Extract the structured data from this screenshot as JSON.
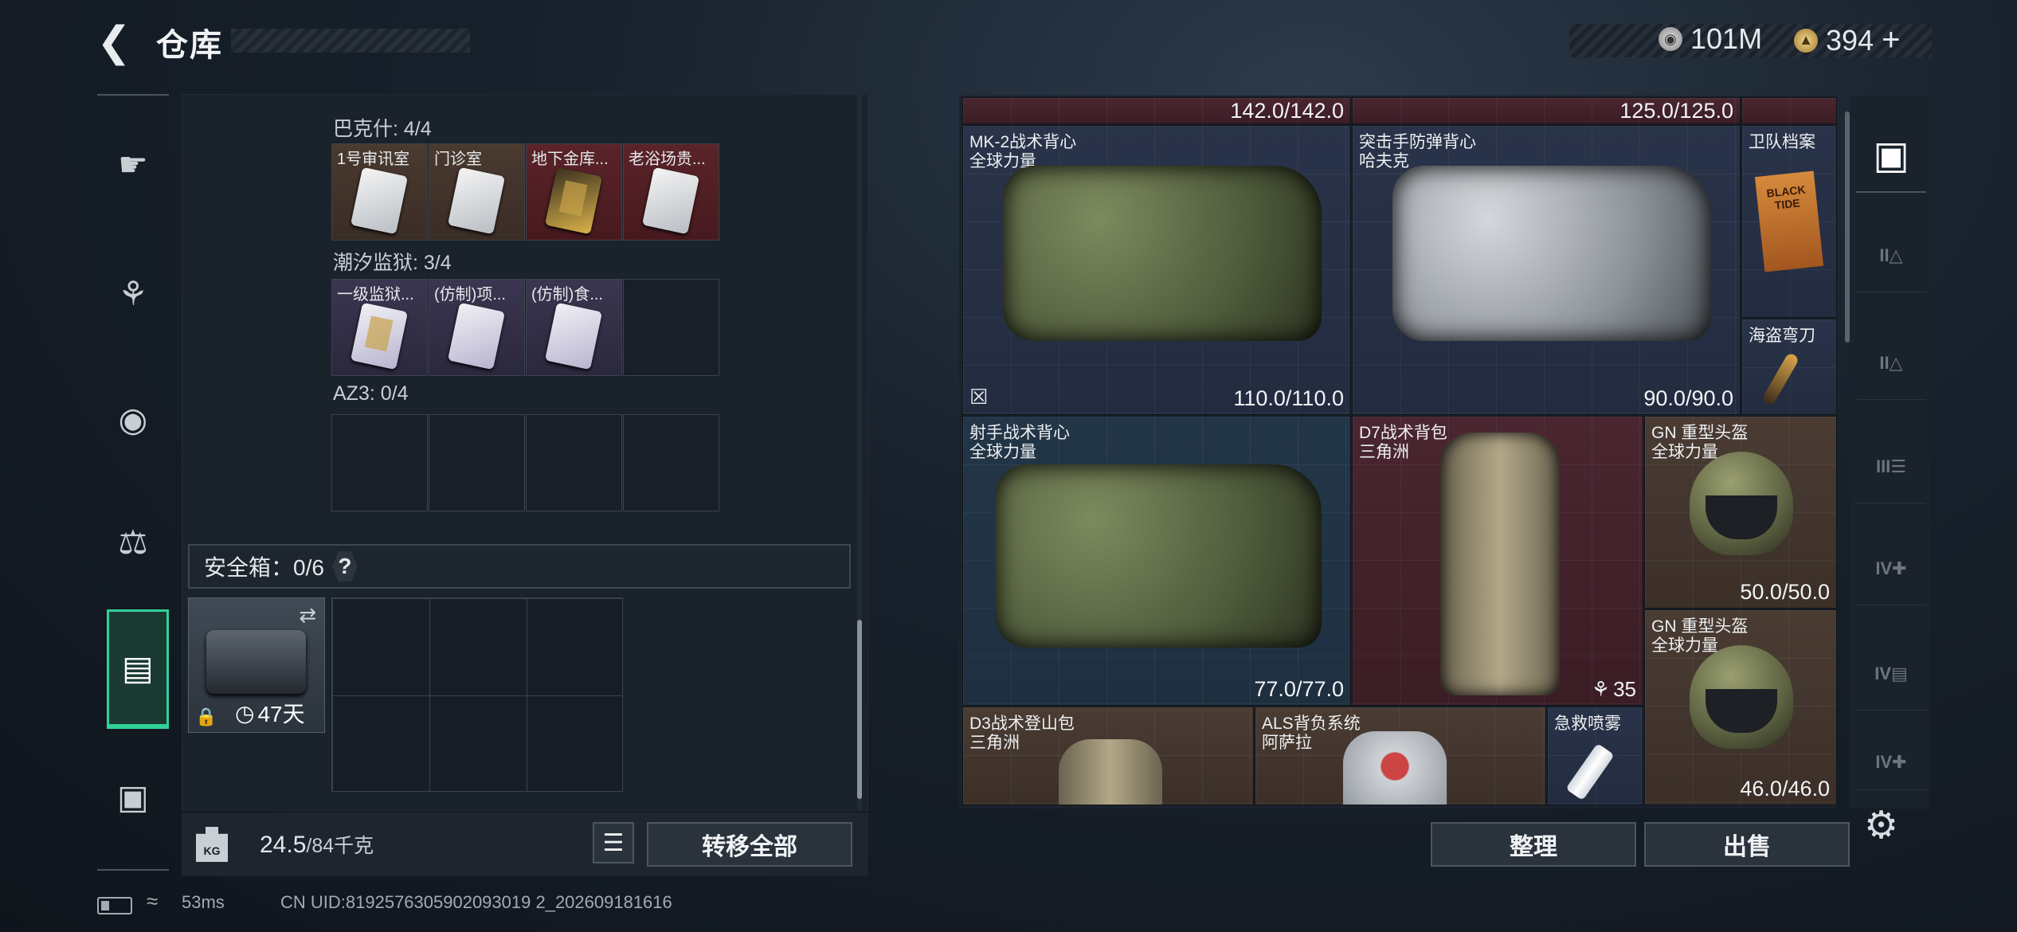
{
  "header": {
    "title": "仓库",
    "currency_silver": "101M",
    "currency_gold": "394",
    "plus": "+"
  },
  "left": {
    "sections": [
      {
        "label": "巴克什: 4/4",
        "slots": [
          "1号审讯室",
          "门诊室",
          "地下金库...",
          "老浴场贵..."
        ]
      },
      {
        "label": "潮汐监狱: 3/4",
        "slots": [
          "一级监狱...",
          "(仿制)项...",
          "(仿制)食..."
        ]
      },
      {
        "label": "AZ3: 0/4"
      }
    ],
    "safe_box": {
      "label": "安全箱：0/6",
      "help": "?",
      "days": "47天"
    },
    "weight": {
      "current": "24.5",
      "max": "/84千克",
      "kg_icon": "KG"
    },
    "transfer_all": "转移全部"
  },
  "right": {
    "top_durability": [
      "142.0/142.0",
      "125.0/125.0"
    ],
    "items": [
      {
        "name": "MK-2战术背心",
        "sub": "全球力量",
        "durability": "110.0/110.0"
      },
      {
        "name": "突击手防弹背心",
        "sub": "哈夫克",
        "durability": "90.0/90.0"
      },
      {
        "name": "卫队档案",
        "book": "BLACK TIDE"
      },
      {
        "name": "海盗弯刀"
      },
      {
        "name": "射手战术背心",
        "sub": "全球力量",
        "durability": "77.0/77.0"
      },
      {
        "name": "D7战术背包",
        "sub": "三角洲",
        "count": "35"
      },
      {
        "name": "GN 重型头盔",
        "sub": "全球力量",
        "durability": "50.0/50.0"
      },
      {
        "name": "GN 重型头盔",
        "sub": "全球力量",
        "durability": "46.0/46.0"
      },
      {
        "name": "D3战术登山包",
        "sub": "三角洲"
      },
      {
        "name": "ALS背负系统",
        "sub": "阿萨拉"
      },
      {
        "name": "急救喷雾"
      }
    ],
    "organize": "整理",
    "sell": "出售",
    "tabs": [
      "II",
      "II",
      "III",
      "IV",
      "IV",
      "IV"
    ]
  },
  "status": {
    "ping": "53ms",
    "uid": "CN UID:8192576305902093019 2_202609181616"
  }
}
